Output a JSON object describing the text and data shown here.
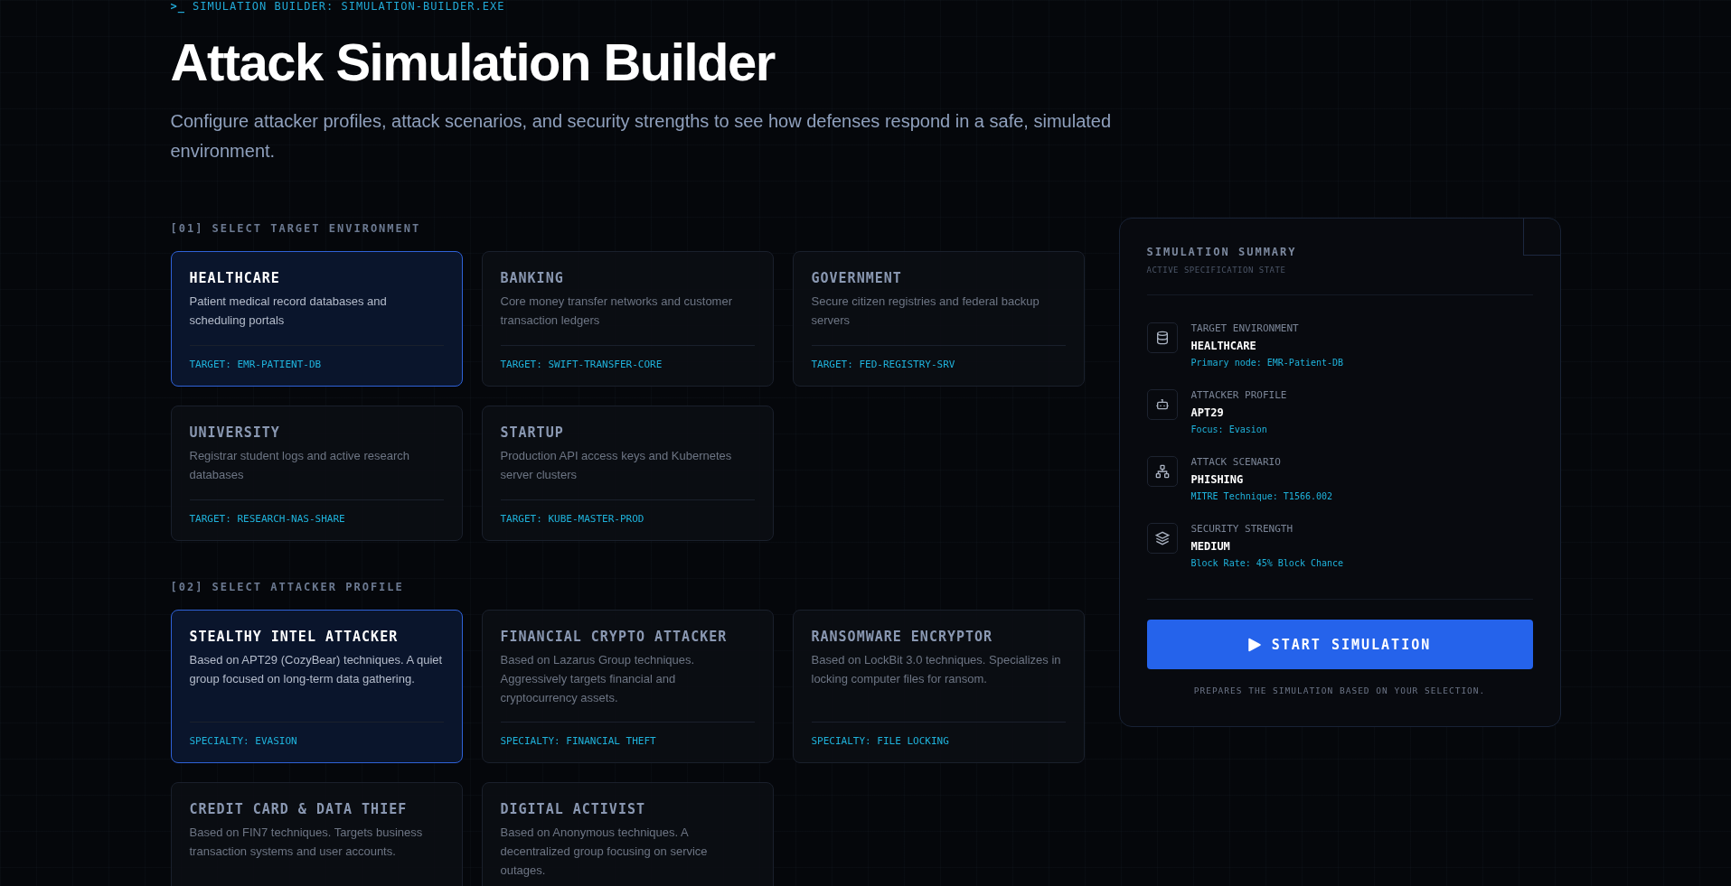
{
  "header": {
    "prompt": ">_",
    "path": "SIMULATION BUILDER: SIMULATION-BUILDER.EXE",
    "title": "Attack Simulation Builder",
    "description": "Configure attacker profiles, attack scenarios, and security strengths to see how defenses respond in a safe, simulated environment."
  },
  "sections": [
    {
      "label": "[01] SELECT TARGET ENVIRONMENT",
      "cards": [
        {
          "title": "HEALTHCARE",
          "description": "Patient medical record databases and scheduling portals",
          "tag": "TARGET: EMR-PATIENT-DB",
          "selected": true
        },
        {
          "title": "BANKING",
          "description": "Core money transfer networks and customer transaction ledgers",
          "tag": "TARGET: SWIFT-TRANSFER-CORE",
          "selected": false
        },
        {
          "title": "GOVERNMENT",
          "description": "Secure citizen registries and federal backup servers",
          "tag": "TARGET: FED-REGISTRY-SRV",
          "selected": false
        },
        {
          "title": "UNIVERSITY",
          "description": "Registrar student logs and active research databases",
          "tag": "TARGET: RESEARCH-NAS-SHARE",
          "selected": false
        },
        {
          "title": "STARTUP",
          "description": "Production API access keys and Kubernetes server clusters",
          "tag": "TARGET: KUBE-MASTER-PROD",
          "selected": false
        }
      ]
    },
    {
      "label": "[02] SELECT ATTACKER PROFILE",
      "cards": [
        {
          "title": "STEALTHY INTEL ATTACKER",
          "description": "Based on APT29 (CozyBear) techniques. A quiet group focused on long-term data gathering.",
          "tag": "SPECIALTY: EVASION",
          "selected": true
        },
        {
          "title": "FINANCIAL CRYPTO ATTACKER",
          "description": "Based on Lazarus Group techniques. Aggressively targets financial and cryptocurrency assets.",
          "tag": "SPECIALTY: FINANCIAL THEFT",
          "selected": false
        },
        {
          "title": "RANSOMWARE ENCRYPTOR",
          "description": "Based on LockBit 3.0 techniques. Specializes in locking computer files for ransom.",
          "tag": "SPECIALTY: FILE LOCKING",
          "selected": false
        },
        {
          "title": "CREDIT CARD & DATA THIEF",
          "description": "Based on FIN7 techniques. Targets business transaction systems and user accounts.",
          "selected": false
        },
        {
          "title": "DIGITAL ACTIVIST",
          "description": "Based on Anonymous techniques. A decentralized group focusing on service outages.",
          "selected": false
        }
      ]
    }
  ],
  "summary": {
    "title": "SIMULATION SUMMARY",
    "subtitle": "ACTIVE SPECIFICATION STATE",
    "items": [
      {
        "kind": "database",
        "label": "TARGET ENVIRONMENT",
        "value": "HEALTHCARE",
        "detail": "Primary node: EMR-Patient-DB"
      },
      {
        "kind": "robot",
        "label": "ATTACKER PROFILE",
        "value": "APT29",
        "detail": "Focus: Evasion"
      },
      {
        "kind": "network",
        "label": "ATTACK SCENARIO",
        "value": "PHISHING",
        "detail": "MITRE Technique: T1566.002"
      },
      {
        "kind": "layers",
        "label": "SECURITY STRENGTH",
        "value": "MEDIUM",
        "detail": "Block Rate: 45% Block Chance"
      }
    ],
    "button": "START SIMULATION",
    "note": "PREPARES THE SIMULATION BASED ON YOUR SELECTION."
  }
}
